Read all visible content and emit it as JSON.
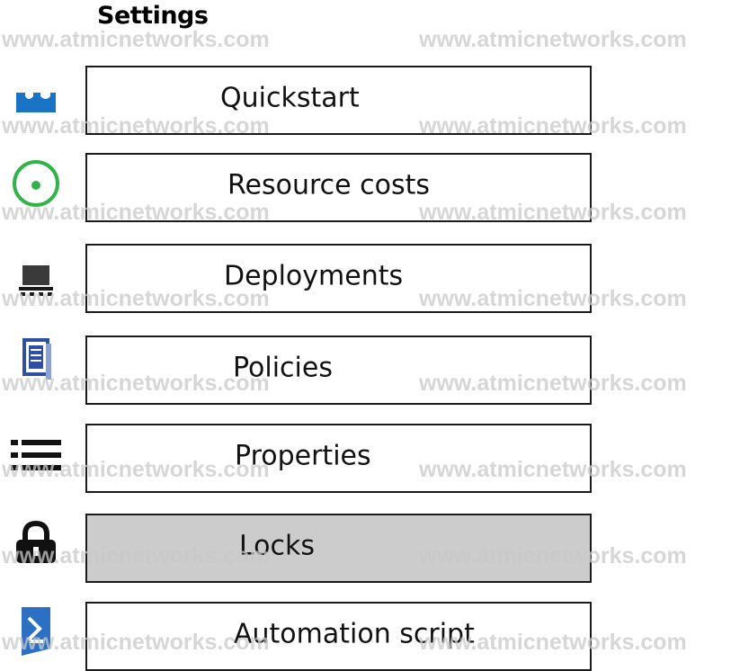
{
  "header": {
    "title": "Settings"
  },
  "watermark": "www.atmicnetworks.com",
  "menu": {
    "items": [
      {
        "label": "Quickstart",
        "icon": "cloud-quickstart-icon",
        "selected": false
      },
      {
        "label": "Resource costs",
        "icon": "resource-costs-icon",
        "selected": false
      },
      {
        "label": "Deployments",
        "icon": "deployments-icon",
        "selected": false
      },
      {
        "label": "Policies",
        "icon": "policies-icon",
        "selected": false
      },
      {
        "label": "Properties",
        "icon": "properties-list-icon",
        "selected": false
      },
      {
        "label": "Locks",
        "icon": "lock-icon",
        "selected": true
      },
      {
        "label": "Automation script",
        "icon": "automation-script-icon",
        "selected": false
      }
    ]
  },
  "colors": {
    "selected_bg": "#cccccc",
    "quickstart_icon": "#1b73c6",
    "resource_costs_icon": "#2fb34a",
    "policies_icon": "#2e4fa3",
    "automation_icon": "#2d6fc3"
  }
}
